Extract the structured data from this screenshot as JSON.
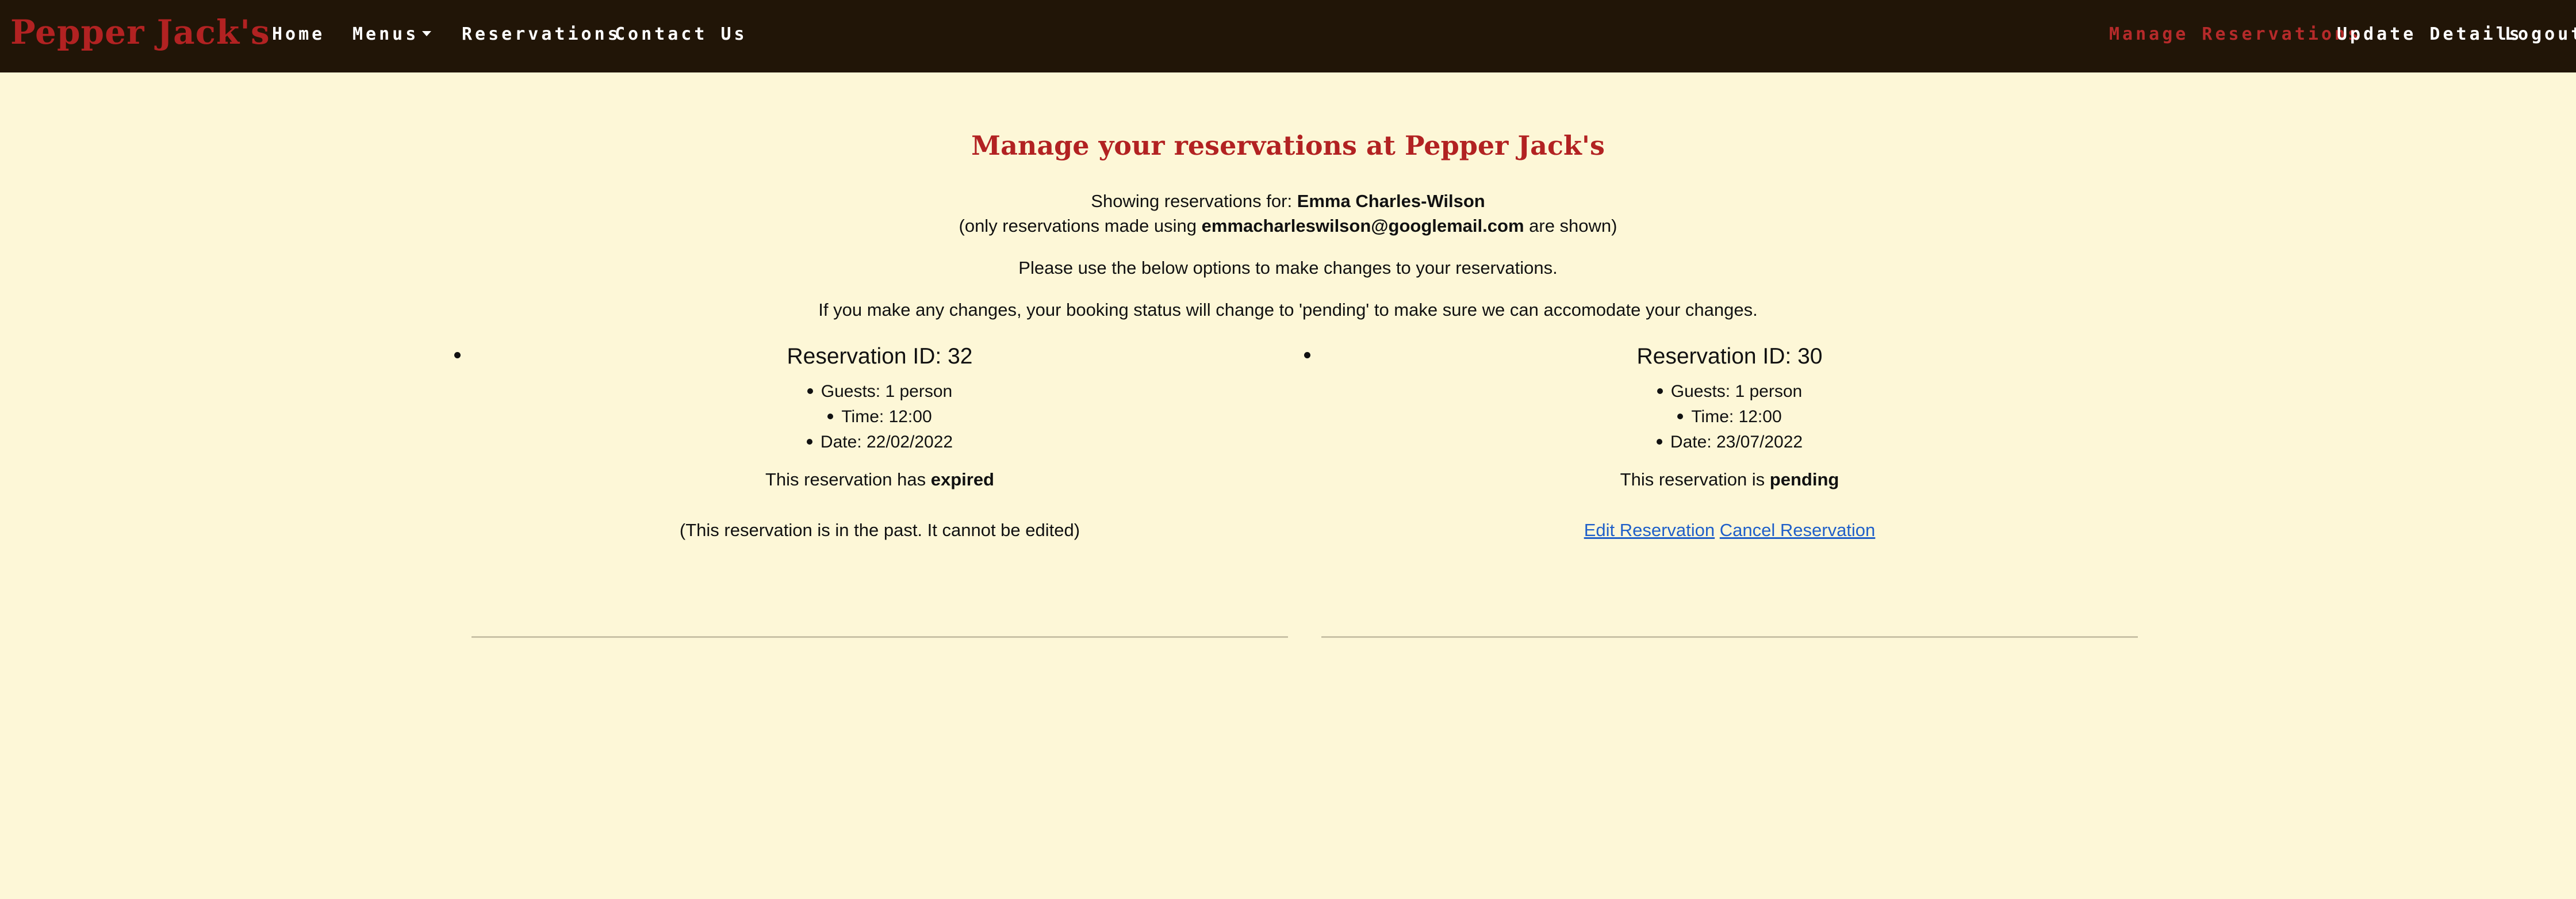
{
  "navbar": {
    "brand": "Pepper Jack's",
    "left_links": {
      "home": "Home",
      "menus": "Menus",
      "reservations": "Reservations",
      "contact": "Contact Us"
    },
    "right_links": {
      "manage": "Manage Reservations",
      "update": "Update Details",
      "logout": "Logout"
    },
    "active_color": "#b52a2a"
  },
  "main": {
    "title": "Manage your reservations at Pepper Jack's",
    "showing_prefix": "Showing reservations for: ",
    "customer_name": "Emma Charles-Wilson",
    "email_prefix": "(only reservations made using ",
    "email": "emmacharleswilson@googlemail.com",
    "email_suffix": " are shown)",
    "instructions": "Please use the below options to make changes to your reservations.",
    "warning": "If you make any changes, your booking status will change to 'pending' to make sure we can accomodate your changes."
  },
  "reservations": [
    {
      "title": "Reservation ID: 32",
      "guests": "Guests: 1 person",
      "time": "Time: 12:00",
      "date": "Date: 22/02/2022",
      "status_prefix": "This reservation has ",
      "status": "expired",
      "note": "(This reservation is in the past. It cannot be edited)"
    },
    {
      "title": "Reservation ID: 30",
      "guests": "Guests: 1 person",
      "time": "Time: 12:00",
      "date": "Date: 23/07/2022",
      "status_prefix": "This reservation is ",
      "status": "pending",
      "edit_label": "Edit Reservation",
      "cancel_label": "Cancel Reservation"
    }
  ],
  "colors": {
    "navbar_bg": "#211507",
    "page_bg": "#fdf7d7",
    "brand": "#b22222",
    "link": "#1f5fc9"
  }
}
